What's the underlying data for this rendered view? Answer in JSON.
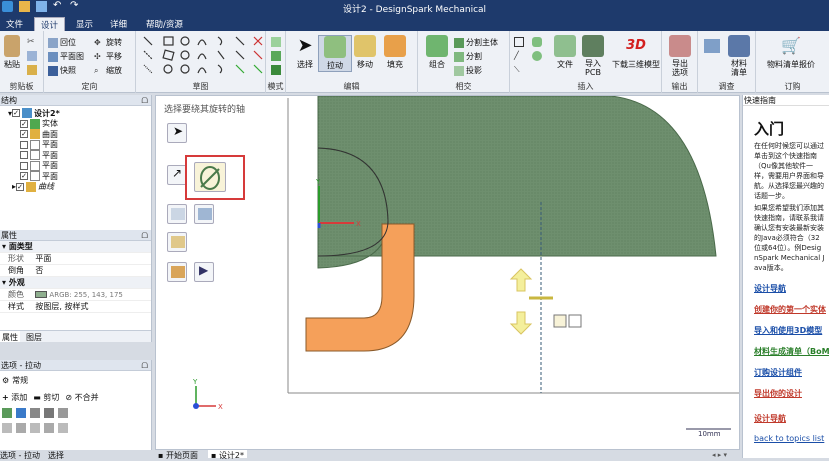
{
  "window": {
    "title": "设计2 - DesignSpark  Mechanical"
  },
  "tabs": [
    "文件",
    "设计",
    "显示",
    "详细",
    "帮助/资源"
  ],
  "active_tab": "设计",
  "ribbon": {
    "clipboard": {
      "label": "剪贴板",
      "paste": "粘贴"
    },
    "orient": {
      "label": "定向",
      "home": "回位",
      "plan_view": "平面图",
      "snap_view": "快照",
      "spin": "旋转",
      "pan": "平移",
      "zoom": "缩放"
    },
    "sketch": {
      "label": "草图"
    },
    "mode": {
      "label": "模式"
    },
    "edit": {
      "label": "编辑",
      "select": "选择",
      "pull": "拉动",
      "move": "移动",
      "fill": "填充"
    },
    "intersect": {
      "label": "相交",
      "combine": "组合",
      "split_body": "分割主体",
      "split": "分割",
      "project": "投影"
    },
    "insert": {
      "label": "插入",
      "file": "文件",
      "import_pcb": "导入\nPCB",
      "download_3d": "下载三维模型"
    },
    "output": {
      "label": "输出",
      "export_options": "导出\n选项"
    },
    "setup": {
      "label": "调查",
      "materials": "材料\n清单"
    },
    "order": {
      "label": "订购",
      "bom_quote": "物料清单报价"
    }
  },
  "structure": {
    "header": "结构",
    "items": [
      {
        "label": "设计2*",
        "bold": true
      },
      {
        "label": "实体"
      },
      {
        "label": "曲面"
      },
      {
        "label": "平面"
      },
      {
        "label": "平面"
      },
      {
        "label": "平面"
      },
      {
        "label": "平面"
      },
      {
        "label": "曲线"
      }
    ]
  },
  "properties": {
    "header": "属性",
    "rows": [
      {
        "name": "面类型",
        "value": "",
        "category": true
      },
      {
        "name": "形状",
        "value": "平面"
      },
      {
        "name": "倒角",
        "value": "否"
      },
      {
        "name": "外观",
        "value": "",
        "category": true
      },
      {
        "name": "颜色",
        "value": "ARGB: 255, 143, 175"
      },
      {
        "name": "样式",
        "value": "按图层, 按样式"
      }
    ],
    "color_swatch": "#8faf8f",
    "tabs": [
      "属性",
      "图层"
    ]
  },
  "options": {
    "header": "选项 - 拉动",
    "general": "常规",
    "add": "添加",
    "cut": "剪切",
    "no_merge": "不合并"
  },
  "bottom_left_tabs": [
    "选项 - 拉动",
    "选择"
  ],
  "canvas": {
    "hint": "选择要绕其旋转的轴",
    "scale_label": "10mm",
    "colors": {
      "green": "#6e8f6e",
      "orange": "#f5a05a",
      "yellow": "#f4ef9c"
    }
  },
  "doc_tabs": [
    "开始页面",
    "设计2*"
  ],
  "quick_guide": {
    "header": "快速指南",
    "title": "入门",
    "body": "在任何时候您可以通过单击到这个快速指南（Qu像其他软件一样，需要用户界面和导航。从选择您最兴趣的话题一步。",
    "body2": "如果您希望我们添加其快速指南，请联系我请确认您有安装最新安装的Java必须符合（32位或64位）。例DesignSpark Mechanical Java版本。",
    "links": [
      "设计导航",
      "创建你的第一个实体",
      "导入和使用3D模型",
      "材料生成清单（BoM",
      "订购设计组件",
      "导出你的设计",
      "设计导航",
      "back to topics list"
    ],
    "link_colors": [
      "#1a4ea8",
      "#c0392b",
      "#1a4ea8",
      "#2a7f2a",
      "#1a4ea8",
      "#c0392b",
      "#c0392b",
      "#1a4ea8"
    ]
  }
}
